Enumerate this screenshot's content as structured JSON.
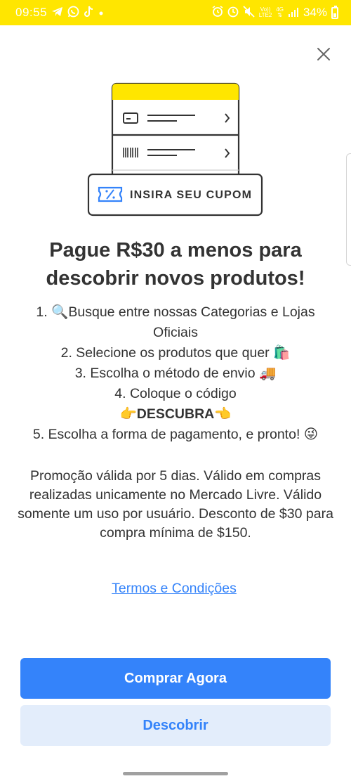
{
  "status_bar": {
    "time": "09:55",
    "left_icons": [
      "telegram-icon",
      "whatsapp-icon",
      "tiktok-icon",
      "dot-icon"
    ],
    "right_icons": [
      "alarm-icon",
      "mute-icon",
      "volte-icon",
      "4g-icon",
      "signal-icon"
    ],
    "volte_label": "Vo))",
    "lte_label": "LTE2",
    "net_label": "4G",
    "battery": "34%",
    "background": "#FFE600"
  },
  "illustration": {
    "coupon_label": "INSIRA SEU CUPOM",
    "coupon_icon": "percent-ticket-icon",
    "row_icons": [
      "credit-card-icon",
      "barcode-icon"
    ],
    "accent": "#FFE600",
    "icon_color": "#3483FA"
  },
  "headline": "Pague R$30 a menos para descobrir novos produtos!",
  "steps": {
    "s1": "1. 🔍Busque entre nossas Categorias e Lojas Oficiais",
    "s2": "2. Selecione os produtos que quer 🛍️",
    "s3": "3. Escolha o método de envio 🚚",
    "s4": "4. Coloque o código",
    "code": "👉DESCUBRA👈",
    "s5": "5. Escolha a forma de pagamento, e pronto! 😜"
  },
  "promo_text": "Promoção válida por 5 dias. Válido em compras realizadas unicamente no Mercado Livre. Válido somente um uso por usuário. Desconto de $30 para compra mínima de $150.",
  "terms_link": "Termos e Condições",
  "buttons": {
    "primary": "Comprar Agora",
    "secondary": "Descobrir"
  },
  "colors": {
    "brand_yellow": "#FFE600",
    "primary_blue": "#3483FA",
    "secondary_bg": "#E3EDFB",
    "text": "#333333"
  }
}
